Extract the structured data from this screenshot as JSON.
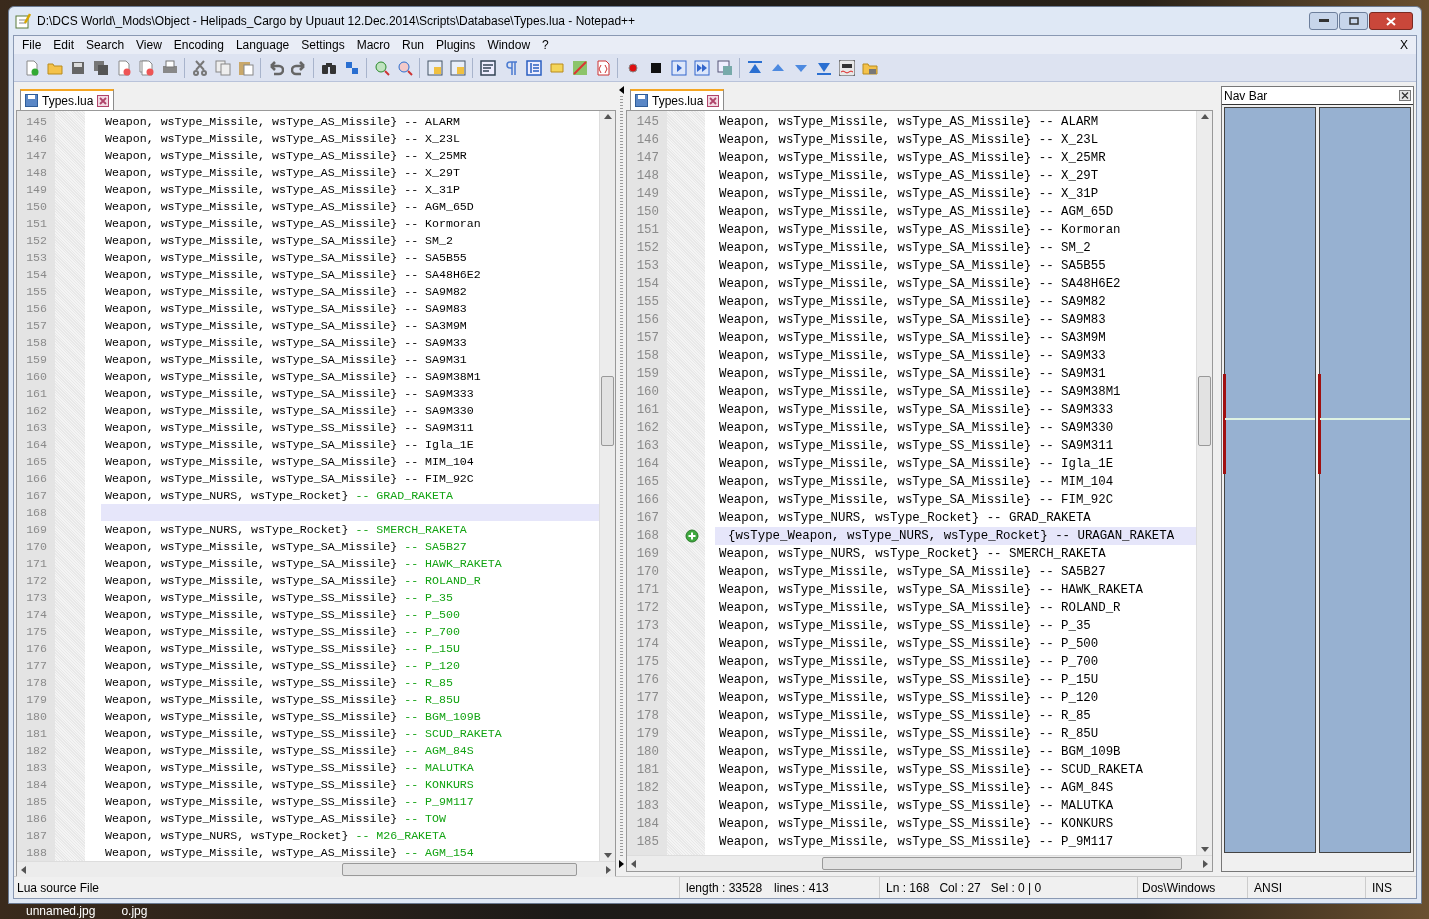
{
  "window": {
    "title": "D:\\DCS World\\_Mods\\Object - Helipads_Cargo by Upuaut 12.Dec.2014\\Scripts\\Database\\Types.lua - Notepad++"
  },
  "menu": [
    "File",
    "Edit",
    "Search",
    "View",
    "Encoding",
    "Language",
    "Settings",
    "Macro",
    "Run",
    "Plugins",
    "Window",
    "?"
  ],
  "menu_close": "X",
  "panes": [
    {
      "tab": {
        "label": "Types.lua",
        "selected": true
      },
      "lines": [
        {
          "n": "145",
          "kind": "line",
          "changed": false,
          "code": "Weapon, wsType_Missile, wsType_AS_Missile}",
          "comment": "-- ALARM"
        },
        {
          "n": "146",
          "kind": "line",
          "changed": false,
          "code": "Weapon, wsType_Missile, wsType_AS_Missile}",
          "comment": "-- X_23L"
        },
        {
          "n": "147",
          "kind": "line",
          "changed": false,
          "code": "Weapon, wsType_Missile, wsType_AS_Missile}",
          "comment": "-- X_25MR"
        },
        {
          "n": "148",
          "kind": "line",
          "changed": false,
          "code": "Weapon, wsType_Missile, wsType_AS_Missile}",
          "comment": "-- X_29T"
        },
        {
          "n": "149",
          "kind": "line",
          "changed": false,
          "code": "Weapon, wsType_Missile, wsType_AS_Missile}",
          "comment": "-- X_31P"
        },
        {
          "n": "150",
          "kind": "line",
          "changed": false,
          "code": "Weapon, wsType_Missile, wsType_AS_Missile}",
          "comment": "-- AGM_65D"
        },
        {
          "n": "151",
          "kind": "line",
          "changed": false,
          "code": "Weapon, wsType_Missile, wsType_AS_Missile}",
          "comment": "-- Kormoran"
        },
        {
          "n": "152",
          "kind": "line",
          "changed": false,
          "code": "Weapon, wsType_Missile, wsType_SA_Missile}",
          "comment": "-- SM_2"
        },
        {
          "n": "153",
          "kind": "line",
          "changed": false,
          "code": "Weapon, wsType_Missile, wsType_SA_Missile}",
          "comment": "-- SA5B55"
        },
        {
          "n": "154",
          "kind": "line",
          "changed": false,
          "code": "Weapon, wsType_Missile, wsType_SA_Missile}",
          "comment": "-- SA48H6E2"
        },
        {
          "n": "155",
          "kind": "line",
          "changed": false,
          "code": "Weapon, wsType_Missile, wsType_SA_Missile}",
          "comment": "-- SA9M82"
        },
        {
          "n": "156",
          "kind": "line",
          "changed": false,
          "code": "Weapon, wsType_Missile, wsType_SA_Missile}",
          "comment": "-- SA9M83"
        },
        {
          "n": "157",
          "kind": "line",
          "changed": false,
          "code": "Weapon, wsType_Missile, wsType_SA_Missile}",
          "comment": "-- SA3M9M"
        },
        {
          "n": "158",
          "kind": "line",
          "changed": false,
          "code": "Weapon, wsType_Missile, wsType_SA_Missile}",
          "comment": "-- SA9M33"
        },
        {
          "n": "159",
          "kind": "line",
          "changed": false,
          "code": "Weapon, wsType_Missile, wsType_SA_Missile}",
          "comment": "-- SA9M31"
        },
        {
          "n": "160",
          "kind": "line",
          "changed": false,
          "code": "Weapon, wsType_Missile, wsType_SA_Missile}",
          "comment": "-- SA9M38M1"
        },
        {
          "n": "161",
          "kind": "line",
          "changed": false,
          "code": "Weapon, wsType_Missile, wsType_SA_Missile}",
          "comment": "-- SA9M333"
        },
        {
          "n": "162",
          "kind": "line",
          "changed": false,
          "code": "Weapon, wsType_Missile, wsType_SA_Missile}",
          "comment": "-- SA9M330"
        },
        {
          "n": "163",
          "kind": "line",
          "changed": false,
          "code": "Weapon, wsType_Missile, wsType_SS_Missile}",
          "comment": "-- SA9M311"
        },
        {
          "n": "164",
          "kind": "line",
          "changed": false,
          "code": "Weapon, wsType_Missile, wsType_SA_Missile}",
          "comment": "-- Igla_1E"
        },
        {
          "n": "165",
          "kind": "line",
          "changed": false,
          "code": "Weapon, wsType_Missile, wsType_SA_Missile}",
          "comment": "-- MIM_104"
        },
        {
          "n": "166",
          "kind": "line",
          "changed": false,
          "code": "Weapon, wsType_Missile, wsType_SA_Missile}",
          "comment": "-- FIM_92C"
        },
        {
          "n": "167",
          "kind": "line",
          "changed": true,
          "code": "Weapon, wsType_NURS, wsType_Rocket}",
          "comment": "-- GRAD_RAKETA"
        },
        {
          "n": "168",
          "kind": "blank"
        },
        {
          "n": "169",
          "kind": "line",
          "changed": true,
          "code": "Weapon, wsType_NURS, wsType_Rocket}",
          "comment": "-- SMERCH_RAKETA"
        },
        {
          "n": "170",
          "kind": "line",
          "changed": true,
          "code": "Weapon, wsType_Missile, wsType_SA_Missile}",
          "comment": "-- SA5B27"
        },
        {
          "n": "171",
          "kind": "line",
          "changed": true,
          "code": "Weapon, wsType_Missile, wsType_SA_Missile}",
          "comment": "-- HAWK_RAKETA"
        },
        {
          "n": "172",
          "kind": "line",
          "changed": true,
          "code": "Weapon, wsType_Missile, wsType_SA_Missile}",
          "comment": "-- ROLAND_R"
        },
        {
          "n": "173",
          "kind": "line",
          "changed": true,
          "code": "Weapon, wsType_Missile, wsType_SS_Missile}",
          "comment": "-- P_35"
        },
        {
          "n": "174",
          "kind": "line",
          "changed": true,
          "code": "Weapon, wsType_Missile, wsType_SS_Missile}",
          "comment": "-- P_500"
        },
        {
          "n": "175",
          "kind": "line",
          "changed": true,
          "code": "Weapon, wsType_Missile, wsType_SS_Missile}",
          "comment": "-- P_700"
        },
        {
          "n": "176",
          "kind": "line",
          "changed": true,
          "code": "Weapon, wsType_Missile, wsType_SS_Missile}",
          "comment": "-- P_15U"
        },
        {
          "n": "177",
          "kind": "line",
          "changed": true,
          "code": "Weapon, wsType_Missile, wsType_SS_Missile}",
          "comment": "-- P_120"
        },
        {
          "n": "178",
          "kind": "line",
          "changed": true,
          "code": "Weapon, wsType_Missile, wsType_SS_Missile}",
          "comment": "-- R_85"
        },
        {
          "n": "179",
          "kind": "line",
          "changed": true,
          "code": "Weapon, wsType_Missile, wsType_SS_Missile}",
          "comment": "-- R_85U"
        },
        {
          "n": "180",
          "kind": "line",
          "changed": true,
          "code": "Weapon, wsType_Missile, wsType_SS_Missile}",
          "comment": "-- BGM_109B"
        },
        {
          "n": "181",
          "kind": "line",
          "changed": true,
          "code": "Weapon, wsType_Missile, wsType_SS_Missile}",
          "comment": "-- SCUD_RAKETA"
        },
        {
          "n": "182",
          "kind": "line",
          "changed": true,
          "code": "Weapon, wsType_Missile, wsType_SS_Missile}",
          "comment": "-- AGM_84S"
        },
        {
          "n": "183",
          "kind": "line",
          "changed": true,
          "code": "Weapon, wsType_Missile, wsType_SS_Missile}",
          "comment": "-- MALUTKA"
        },
        {
          "n": "184",
          "kind": "line",
          "changed": true,
          "code": "Weapon, wsType_Missile, wsType_SS_Missile}",
          "comment": "-- KONKURS"
        },
        {
          "n": "185",
          "kind": "line",
          "changed": true,
          "code": "Weapon, wsType_Missile, wsType_SS_Missile}",
          "comment": "-- P_9M117"
        },
        {
          "n": "186",
          "kind": "line",
          "changed": true,
          "code": "Weapon, wsType_Missile, wsType_AS_Missile}",
          "comment": "-- TOW"
        },
        {
          "n": "187",
          "kind": "line",
          "changed": true,
          "code": "Weapon, wsType_NURS, wsType_Rocket}",
          "comment": "-- M26_RAKETA"
        },
        {
          "n": "188",
          "kind": "line",
          "changed": true,
          "code": "Weapon, wsType_Missile, wsType_AS_Missile}",
          "comment": "-- AGM_154"
        }
      ]
    },
    {
      "tab": {
        "label": "Types.lua",
        "selected": true
      },
      "lines": [
        {
          "n": "145",
          "kind": "line",
          "code": "Weapon, wsType_Missile, wsType_AS_Missile}",
          "comment": "-- ALARM"
        },
        {
          "n": "146",
          "kind": "line",
          "code": "Weapon, wsType_Missile, wsType_AS_Missile}",
          "comment": "-- X_23L"
        },
        {
          "n": "147",
          "kind": "line",
          "code": "Weapon, wsType_Missile, wsType_AS_Missile}",
          "comment": "-- X_25MR"
        },
        {
          "n": "148",
          "kind": "line",
          "code": "Weapon, wsType_Missile, wsType_AS_Missile}",
          "comment": "-- X_29T"
        },
        {
          "n": "149",
          "kind": "line",
          "code": "Weapon, wsType_Missile, wsType_AS_Missile}",
          "comment": "-- X_31P"
        },
        {
          "n": "150",
          "kind": "line",
          "code": "Weapon, wsType_Missile, wsType_AS_Missile}",
          "comment": "-- AGM_65D"
        },
        {
          "n": "151",
          "kind": "line",
          "code": "Weapon, wsType_Missile, wsType_AS_Missile}",
          "comment": "-- Kormoran"
        },
        {
          "n": "152",
          "kind": "line",
          "code": "Weapon, wsType_Missile, wsType_SA_Missile}",
          "comment": "-- SM_2"
        },
        {
          "n": "153",
          "kind": "line",
          "code": "Weapon, wsType_Missile, wsType_SA_Missile}",
          "comment": "-- SA5B55"
        },
        {
          "n": "154",
          "kind": "line",
          "code": "Weapon, wsType_Missile, wsType_SA_Missile}",
          "comment": "-- SA48H6E2"
        },
        {
          "n": "155",
          "kind": "line",
          "code": "Weapon, wsType_Missile, wsType_SA_Missile}",
          "comment": "-- SA9M82"
        },
        {
          "n": "156",
          "kind": "line",
          "code": "Weapon, wsType_Missile, wsType_SA_Missile}",
          "comment": "-- SA9M83"
        },
        {
          "n": "157",
          "kind": "line",
          "code": "Weapon, wsType_Missile, wsType_SA_Missile}",
          "comment": "-- SA3M9M"
        },
        {
          "n": "158",
          "kind": "line",
          "code": "Weapon, wsType_Missile, wsType_SA_Missile}",
          "comment": "-- SA9M33"
        },
        {
          "n": "159",
          "kind": "line",
          "code": "Weapon, wsType_Missile, wsType_SA_Missile}",
          "comment": "-- SA9M31"
        },
        {
          "n": "160",
          "kind": "line",
          "code": "Weapon, wsType_Missile, wsType_SA_Missile}",
          "comment": "-- SA9M38M1"
        },
        {
          "n": "161",
          "kind": "line",
          "code": "Weapon, wsType_Missile, wsType_SA_Missile}",
          "comment": "-- SA9M333"
        },
        {
          "n": "162",
          "kind": "line",
          "code": "Weapon, wsType_Missile, wsType_SA_Missile}",
          "comment": "-- SA9M330"
        },
        {
          "n": "163",
          "kind": "line",
          "code": "Weapon, wsType_Missile, wsType_SS_Missile}",
          "comment": "-- SA9M311"
        },
        {
          "n": "164",
          "kind": "line",
          "code": "Weapon, wsType_Missile, wsType_SA_Missile}",
          "comment": "-- Igla_1E"
        },
        {
          "n": "165",
          "kind": "line",
          "code": "Weapon, wsType_Missile, wsType_SA_Missile}",
          "comment": "-- MIM_104"
        },
        {
          "n": "166",
          "kind": "line",
          "code": "Weapon, wsType_Missile, wsType_SA_Missile}",
          "comment": "-- FIM_92C"
        },
        {
          "n": "167",
          "kind": "line",
          "code": "Weapon, wsType_NURS, wsType_Rocket}",
          "comment": "-- GRAD_RAKETA"
        },
        {
          "n": "168",
          "kind": "added",
          "code": "{wsType_Weapon, wsType_NURS, wsType_Rocket}",
          "comment": "-- URAGAN_RAKETA"
        },
        {
          "n": "169",
          "kind": "line",
          "code": "Weapon, wsType_NURS, wsType_Rocket}",
          "comment": "-- SMERCH_RAKETA"
        },
        {
          "n": "170",
          "kind": "line",
          "code": "Weapon, wsType_Missile, wsType_SA_Missile}",
          "comment": "-- SA5B27"
        },
        {
          "n": "171",
          "kind": "line",
          "code": "Weapon, wsType_Missile, wsType_SA_Missile}",
          "comment": "-- HAWK_RAKETA"
        },
        {
          "n": "172",
          "kind": "line",
          "code": "Weapon, wsType_Missile, wsType_SA_Missile}",
          "comment": "-- ROLAND_R"
        },
        {
          "n": "173",
          "kind": "line",
          "code": "Weapon, wsType_Missile, wsType_SS_Missile}",
          "comment": "-- P_35"
        },
        {
          "n": "174",
          "kind": "line",
          "code": "Weapon, wsType_Missile, wsType_SS_Missile}",
          "comment": "-- P_500"
        },
        {
          "n": "175",
          "kind": "line",
          "code": "Weapon, wsType_Missile, wsType_SS_Missile}",
          "comment": "-- P_700"
        },
        {
          "n": "176",
          "kind": "line",
          "code": "Weapon, wsType_Missile, wsType_SS_Missile}",
          "comment": "-- P_15U"
        },
        {
          "n": "177",
          "kind": "line",
          "code": "Weapon, wsType_Missile, wsType_SS_Missile}",
          "comment": "-- P_120"
        },
        {
          "n": "178",
          "kind": "line",
          "code": "Weapon, wsType_Missile, wsType_SS_Missile}",
          "comment": "-- R_85"
        },
        {
          "n": "179",
          "kind": "line",
          "code": "Weapon, wsType_Missile, wsType_SS_Missile}",
          "comment": "-- R_85U"
        },
        {
          "n": "180",
          "kind": "line",
          "code": "Weapon, wsType_Missile, wsType_SS_Missile}",
          "comment": "-- BGM_109B"
        },
        {
          "n": "181",
          "kind": "line",
          "code": "Weapon, wsType_Missile, wsType_SS_Missile}",
          "comment": "-- SCUD_RAKETA"
        },
        {
          "n": "182",
          "kind": "line",
          "code": "Weapon, wsType_Missile, wsType_SS_Missile}",
          "comment": "-- AGM_84S"
        },
        {
          "n": "183",
          "kind": "line",
          "code": "Weapon, wsType_Missile, wsType_SS_Missile}",
          "comment": "-- MALUTKA"
        },
        {
          "n": "184",
          "kind": "line",
          "code": "Weapon, wsType_Missile, wsType_SS_Missile}",
          "comment": "-- KONKURS"
        },
        {
          "n": "185",
          "kind": "line",
          "code": "Weapon, wsType_Missile, wsType_SS_Missile}",
          "comment": "-- P_9M117"
        }
      ]
    }
  ],
  "nav_bar": {
    "title": "Nav Bar"
  },
  "status_bar": {
    "file_type": "Lua source File",
    "length": "length : 33528",
    "lines": "lines : 413",
    "ln": "Ln : 168",
    "col": "Col : 27",
    "sel": "Sel : 0 | 0",
    "eol": "Dos\\Windows",
    "encoding": "ANSI",
    "mode": "INS"
  },
  "taskbar": [
    "unnamed.jpg",
    "o.jpg"
  ]
}
